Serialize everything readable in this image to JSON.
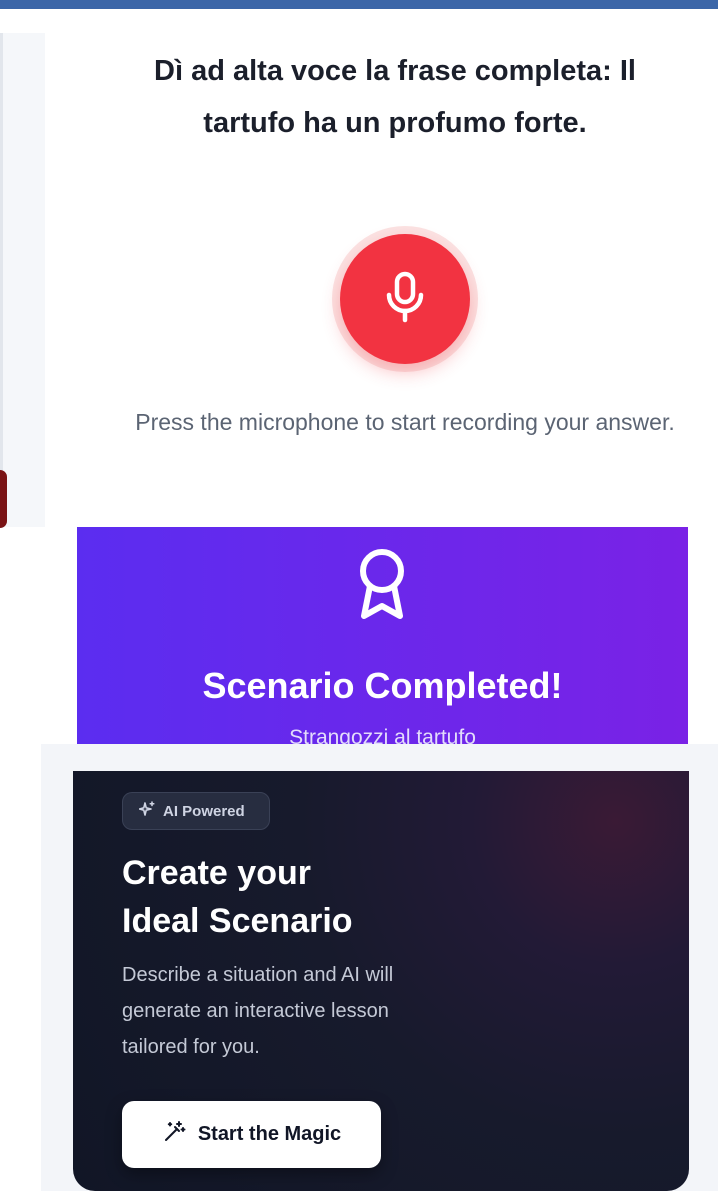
{
  "exercise": {
    "prompt": "Dì ad alta voce la frase completa: Il tartufo ha un profumo forte.",
    "mic_icon": "microphone-icon",
    "hint": "Press the microphone to start recording your answer."
  },
  "completed": {
    "icon": "award-icon",
    "title": "Scenario Completed!",
    "subtitle": "Strangozzi al tartufo"
  },
  "ai_card": {
    "badge_icon": "sparkles-icon",
    "badge_label": "AI Powered",
    "title_line1": "Create your",
    "title_line2": "Ideal Scenario",
    "description": "Describe a situation and AI will generate an interactive lesson tailored for you.",
    "button_icon": "magic-wand-icon",
    "button_label": "Start the Magic"
  },
  "colors": {
    "mic_red": "#f23341",
    "banner_start": "#5b2df0",
    "banner_end": "#7a22e6",
    "card_dark": "#111626"
  }
}
